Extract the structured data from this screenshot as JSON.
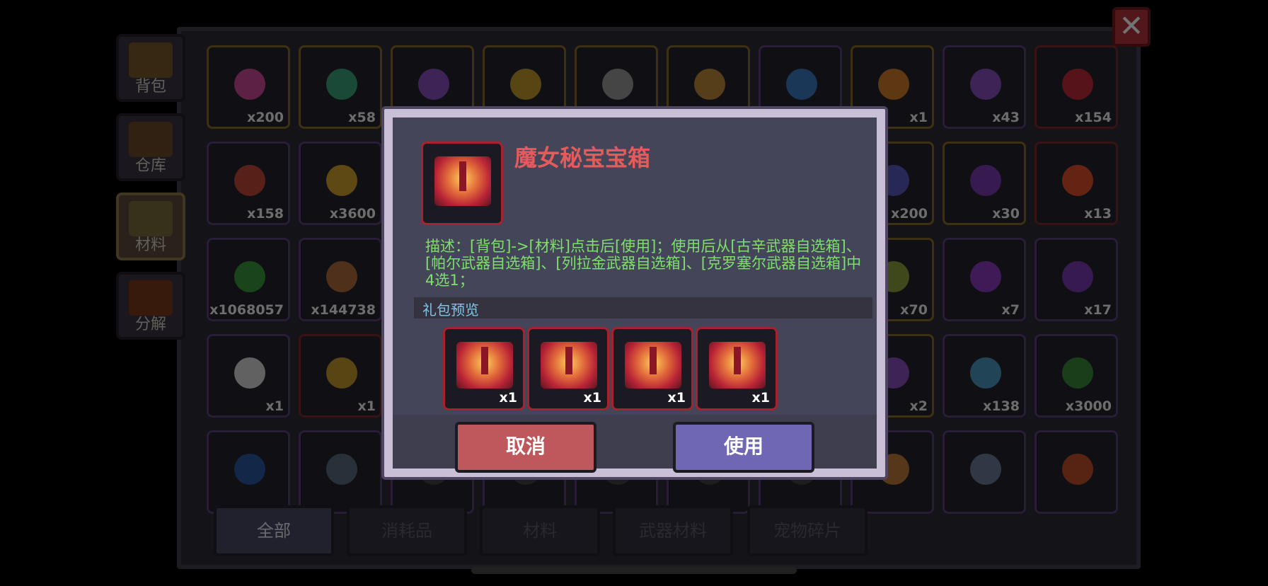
{
  "close_label": "✕",
  "side_tabs": [
    {
      "label": "背包",
      "active": false,
      "icon": "backpack-chest-icon"
    },
    {
      "label": "仓库",
      "active": false,
      "icon": "warehouse-chest-icon"
    },
    {
      "label": "材料",
      "active": true,
      "icon": "materials-icon"
    },
    {
      "label": "分解",
      "active": false,
      "icon": "disassemble-pot-icon"
    }
  ],
  "grid_items": [
    {
      "count": "x200",
      "color": "#d04a9c",
      "frame": "gold"
    },
    {
      "count": "x58",
      "color": "#3aa37d",
      "frame": "gold"
    },
    {
      "count": "",
      "color": "#8a4fc0",
      "frame": "gold"
    },
    {
      "count": "",
      "color": "#c09a2a",
      "frame": "gold"
    },
    {
      "count": "",
      "color": "#9a9a9a",
      "frame": "gold"
    },
    {
      "count": "",
      "color": "#c08a3a",
      "frame": "gold"
    },
    {
      "count": "",
      "color": "#3a7ac0",
      "frame": "purple"
    },
    {
      "count": "x1",
      "color": "#d07a2a",
      "frame": "gold"
    },
    {
      "count": "x43",
      "color": "#8a4fc0",
      "frame": "purple"
    },
    {
      "count": "x154",
      "color": "#c02a3a",
      "frame": "red"
    },
    {
      "count": "x158",
      "color": "#c04a3a",
      "frame": "purple"
    },
    {
      "count": "x3600",
      "color": "#d0a02a",
      "frame": "purple"
    },
    {
      "count": "",
      "color": "#444",
      "frame": "purple"
    },
    {
      "count": "",
      "color": "#444",
      "frame": "purple"
    },
    {
      "count": "",
      "color": "#444",
      "frame": "purple"
    },
    {
      "count": "",
      "color": "#444",
      "frame": "purple"
    },
    {
      "count": "",
      "color": "#444",
      "frame": "purple"
    },
    {
      "count": "x200",
      "color": "#5a5ac0",
      "frame": "gold"
    },
    {
      "count": "x30",
      "color": "#7a3ab0",
      "frame": "gold"
    },
    {
      "count": "x13",
      "color": "#e0502a",
      "frame": "red"
    },
    {
      "count": "x1068057",
      "color": "#3a9a3a",
      "frame": "purple"
    },
    {
      "count": "x144738",
      "color": "#b06a3a",
      "frame": "purple"
    },
    {
      "count": "",
      "color": "#444",
      "frame": "purple"
    },
    {
      "count": "",
      "color": "#444",
      "frame": "purple"
    },
    {
      "count": "",
      "color": "#444",
      "frame": "purple"
    },
    {
      "count": "",
      "color": "#444",
      "frame": "purple"
    },
    {
      "count": "",
      "color": "#444",
      "frame": "purple"
    },
    {
      "count": "x70",
      "color": "#8aa03a",
      "frame": "gold"
    },
    {
      "count": "x7",
      "color": "#8a3ac0",
      "frame": "purple"
    },
    {
      "count": "x17",
      "color": "#7a3ab0",
      "frame": "purple"
    },
    {
      "count": "x1",
      "color": "#d8d8d8",
      "frame": "purple"
    },
    {
      "count": "x1",
      "color": "#c09a2a",
      "frame": "red"
    },
    {
      "count": "",
      "color": "#444",
      "frame": "purple"
    },
    {
      "count": "",
      "color": "#444",
      "frame": "purple"
    },
    {
      "count": "",
      "color": "#444",
      "frame": "purple"
    },
    {
      "count": "",
      "color": "#444",
      "frame": "purple"
    },
    {
      "count": "",
      "color": "#444",
      "frame": "purple"
    },
    {
      "count": "x2",
      "color": "#8a4fc0",
      "frame": "gold"
    },
    {
      "count": "x138",
      "color": "#4a9ac0",
      "frame": "purple"
    },
    {
      "count": "x3000",
      "color": "#3a8a3a",
      "frame": "purple"
    },
    {
      "count": "",
      "color": "#2a5aa0",
      "frame": "purple"
    },
    {
      "count": "",
      "color": "#5a6a80",
      "frame": "purple"
    },
    {
      "count": "",
      "color": "#444",
      "frame": "purple"
    },
    {
      "count": "",
      "color": "#444",
      "frame": "purple"
    },
    {
      "count": "",
      "color": "#444",
      "frame": "purple"
    },
    {
      "count": "",
      "color": "#444",
      "frame": "purple"
    },
    {
      "count": "",
      "color": "#444",
      "frame": "purple"
    },
    {
      "count": "",
      "color": "#c07a3a",
      "frame": "purple"
    },
    {
      "count": "",
      "color": "#6a7a9a",
      "frame": "purple"
    },
    {
      "count": "",
      "color": "#c0502a",
      "frame": "purple"
    }
  ],
  "bottom_tabs": [
    {
      "label": "全部",
      "active": true
    },
    {
      "label": "消耗品",
      "active": false
    },
    {
      "label": "材料",
      "active": false
    },
    {
      "label": "武器材料",
      "active": false
    },
    {
      "label": "宠物碎片",
      "active": false
    }
  ],
  "dialog": {
    "title": "魔女秘宝宝箱",
    "description": "描述：[背包]->[材料]点击后[使用]；使用后从[古辛武器自选箱]、[帕尔武器自选箱]、[列拉金武器自选箱]、[克罗塞尔武器自选箱]中4选1；",
    "preview_label": "礼包预览",
    "preview_items": [
      {
        "count": "x1"
      },
      {
        "count": "x1"
      },
      {
        "count": "x1"
      },
      {
        "count": "x1"
      }
    ],
    "cancel_label": "取消",
    "use_label": "使用"
  }
}
